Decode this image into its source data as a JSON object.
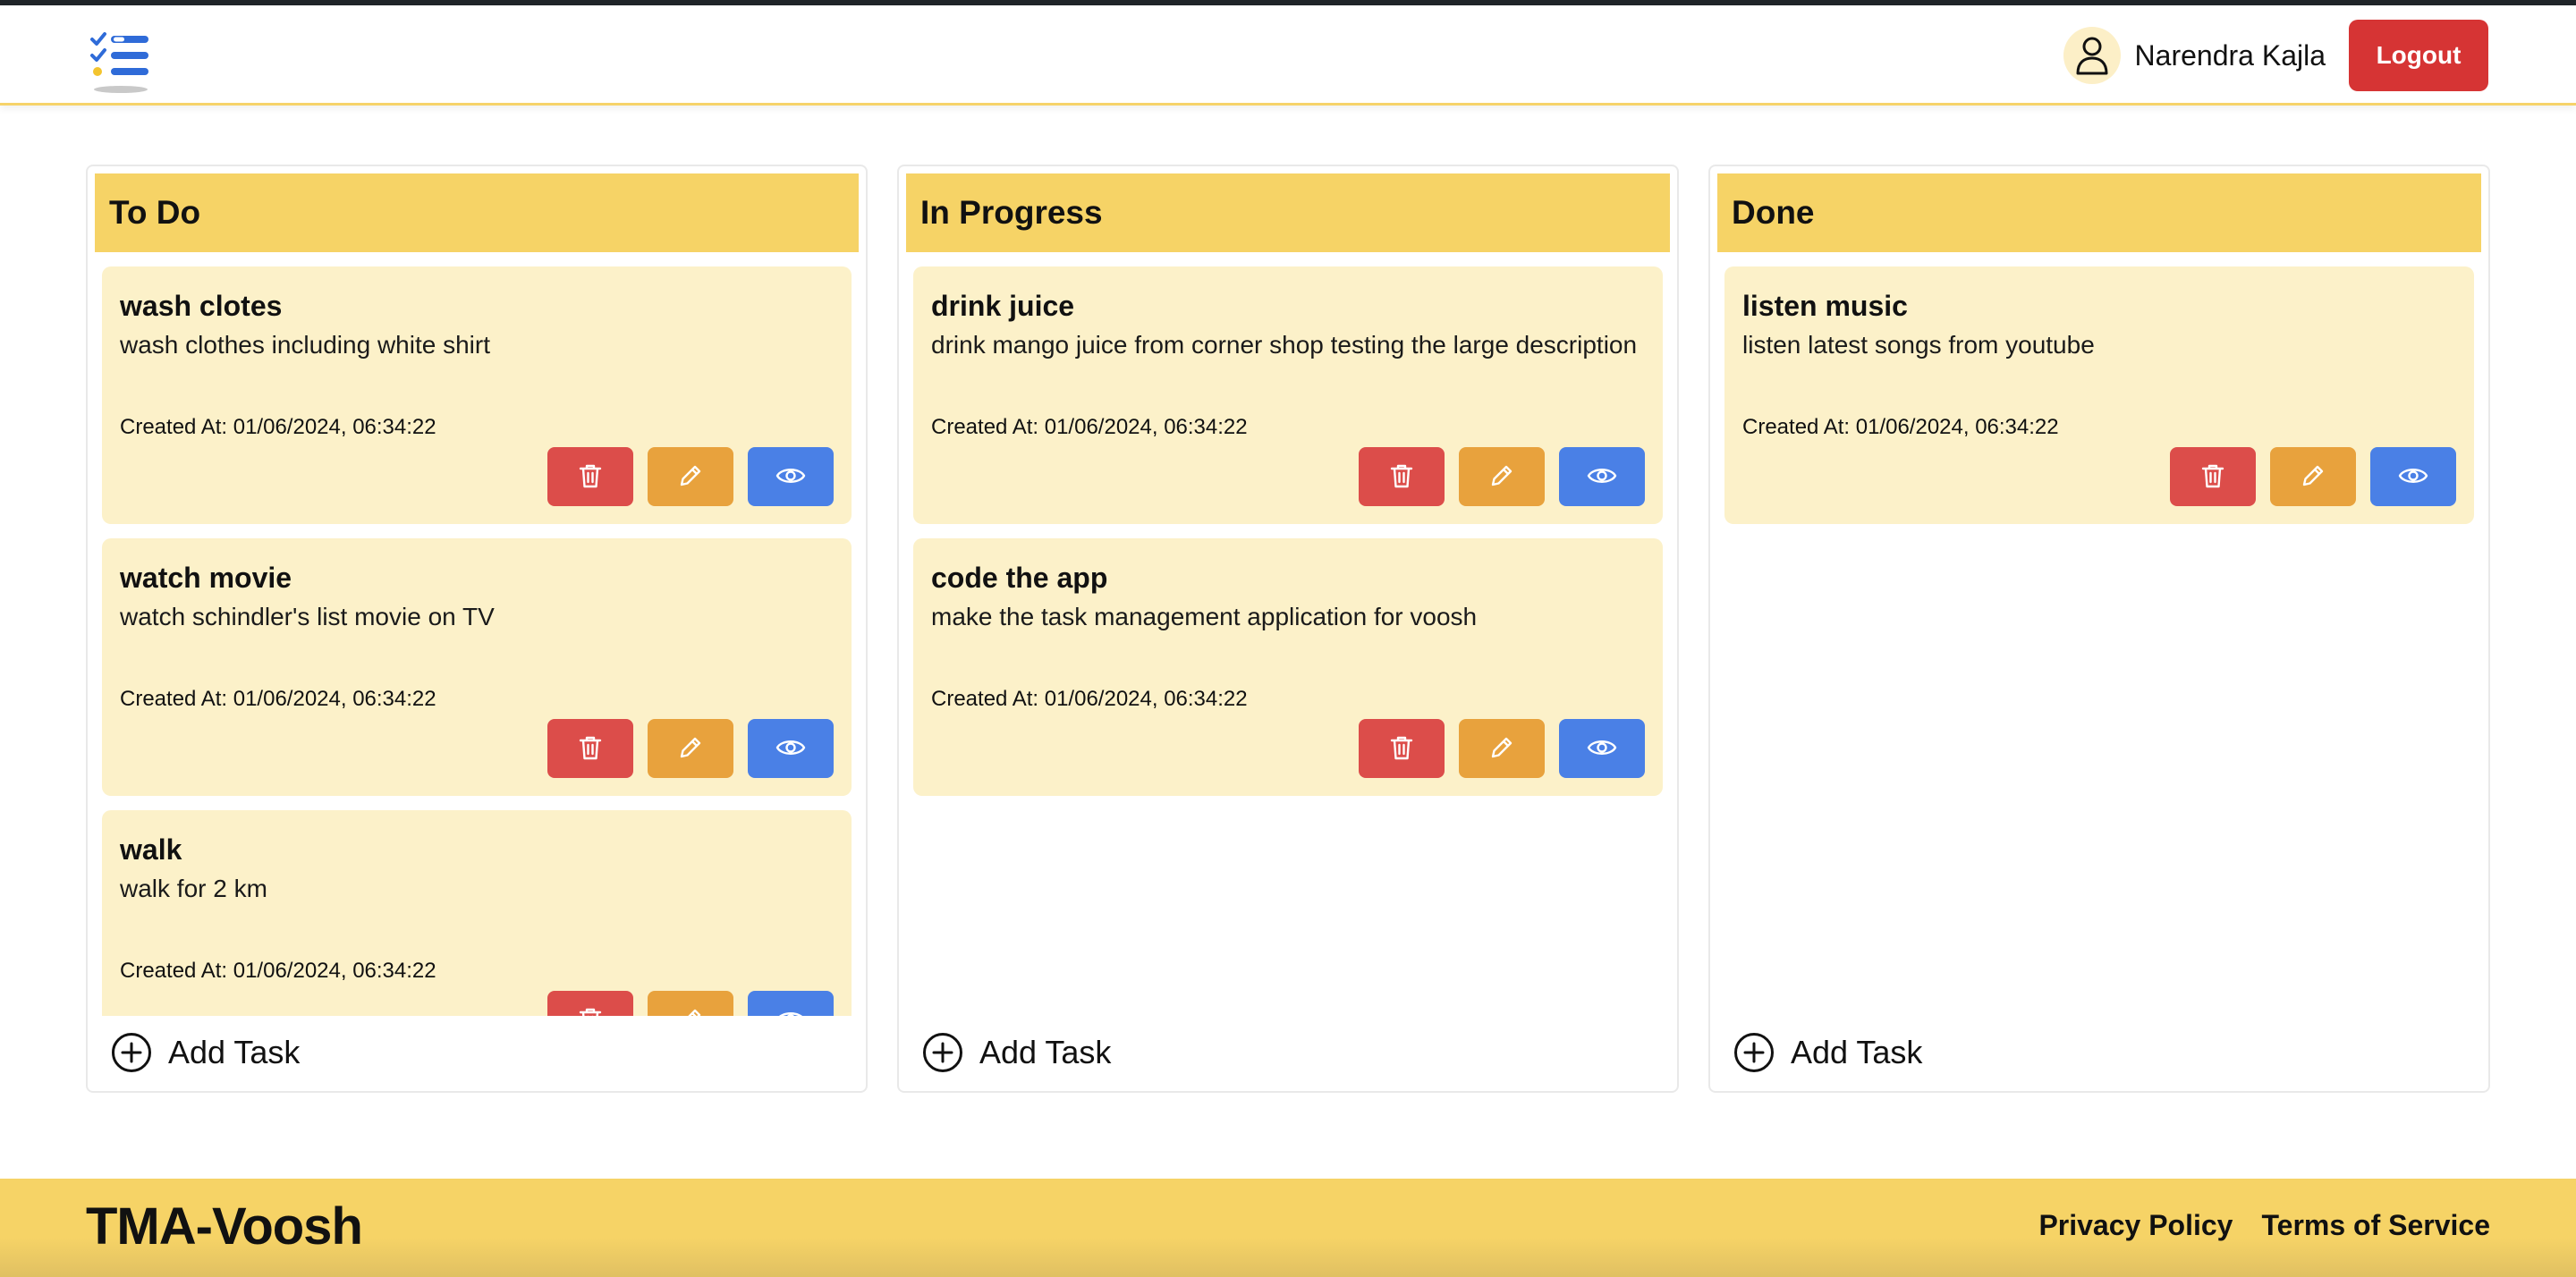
{
  "header": {
    "logo_icon": "checklist-logo-icon",
    "user_icon": "user-icon",
    "user_name": "Narendra Kajla",
    "logout_label": "Logout"
  },
  "colors": {
    "accent_yellow": "#f6d366",
    "card_bg": "#fcf1c9",
    "delete": "#dc4d4a",
    "edit": "#e8a23d",
    "view": "#4a80e6",
    "logout": "#d63434"
  },
  "board": {
    "add_task_label": "Add Task",
    "columns": [
      {
        "title": "To Do",
        "tasks": [
          {
            "title": "wash clotes",
            "description": "wash clothes including white shirt",
            "created": "Created At: 01/06/2024, 06:34:22"
          },
          {
            "title": "watch movie",
            "description": "watch schindler's list movie on TV",
            "created": "Created At: 01/06/2024, 06:34:22"
          },
          {
            "title": "walk",
            "description": "walk for 2 km",
            "created": "Created At: 01/06/2024, 06:34:22"
          }
        ]
      },
      {
        "title": "In Progress",
        "tasks": [
          {
            "title": "drink juice",
            "description": "drink mango juice from corner shop testing the large description",
            "created": "Created At: 01/06/2024, 06:34:22"
          },
          {
            "title": "code the app",
            "description": "make the task management application for voosh",
            "created": "Created At: 01/06/2024, 06:34:22"
          }
        ]
      },
      {
        "title": "Done",
        "tasks": [
          {
            "title": "listen music",
            "description": "listen latest songs from youtube",
            "created": "Created At: 01/06/2024, 06:34:22"
          }
        ]
      }
    ]
  },
  "footer": {
    "brand": "TMA-Voosh",
    "privacy_label": "Privacy Policy",
    "terms_label": "Terms of Service"
  }
}
